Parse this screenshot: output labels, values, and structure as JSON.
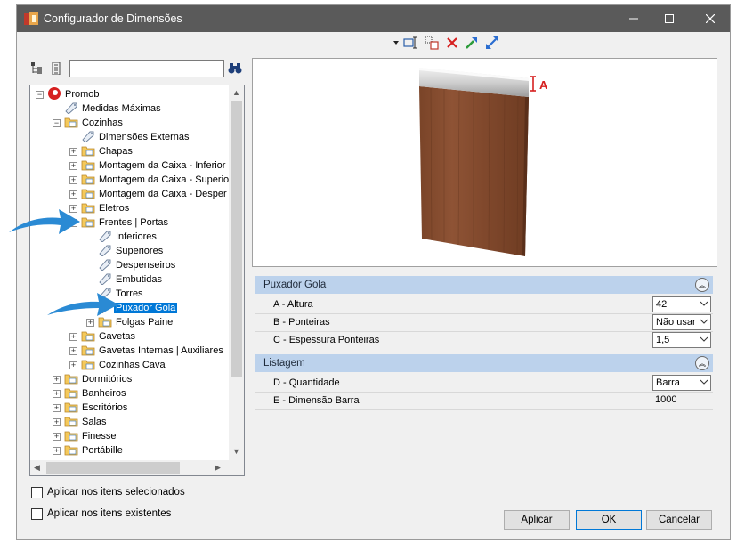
{
  "window": {
    "title": "Configurador de Dimensões"
  },
  "toolbar": {
    "icons": [
      "dropdown-arrow-icon",
      "text-frame-icon",
      "copy-dimension-icon",
      "delete-icon",
      "arrow-up-right-icon",
      "arrow-diagonal-icon"
    ]
  },
  "tree": {
    "items": [
      {
        "label": "Promob",
        "level": 0,
        "expander": "minus",
        "icon": "promob-logo-icon",
        "selected": false
      },
      {
        "label": "Medidas Máximas",
        "level": 1,
        "expander": "",
        "icon": "tag-icon",
        "selected": false
      },
      {
        "label": "Cozinhas",
        "level": 1,
        "expander": "minus",
        "icon": "folder-icon",
        "selected": false
      },
      {
        "label": "Dimensões Externas",
        "level": 2,
        "expander": "",
        "icon": "tag-icon",
        "selected": false
      },
      {
        "label": "Chapas",
        "level": 2,
        "expander": "plus",
        "icon": "folder-icon",
        "selected": false
      },
      {
        "label": "Montagem da Caixa - Inferior",
        "level": 2,
        "expander": "plus",
        "icon": "folder-icon",
        "selected": false
      },
      {
        "label": "Montagem da Caixa - Superio",
        "level": 2,
        "expander": "plus",
        "icon": "folder-icon",
        "selected": false
      },
      {
        "label": "Montagem da Caixa - Desper",
        "level": 2,
        "expander": "plus",
        "icon": "folder-icon",
        "selected": false
      },
      {
        "label": "Eletros",
        "level": 2,
        "expander": "plus",
        "icon": "folder-icon",
        "selected": false
      },
      {
        "label": "Frentes | Portas",
        "level": 2,
        "expander": "minus",
        "icon": "folder-icon",
        "selected": false
      },
      {
        "label": "Inferiores",
        "level": 3,
        "expander": "",
        "icon": "tag-icon",
        "selected": false
      },
      {
        "label": "Superiores",
        "level": 3,
        "expander": "",
        "icon": "tag-icon",
        "selected": false
      },
      {
        "label": "Despenseiros",
        "level": 3,
        "expander": "",
        "icon": "tag-icon",
        "selected": false
      },
      {
        "label": "Embutidas",
        "level": 3,
        "expander": "",
        "icon": "tag-icon",
        "selected": false
      },
      {
        "label": "Torres",
        "level": 3,
        "expander": "",
        "icon": "tag-icon",
        "selected": false
      },
      {
        "label": "Puxador Gola",
        "level": 3,
        "expander": "",
        "icon": "tag-icon",
        "selected": true
      },
      {
        "label": "Folgas Painel",
        "level": 3,
        "expander": "plus",
        "icon": "folder-icon",
        "selected": false
      },
      {
        "label": "Gavetas",
        "level": 2,
        "expander": "plus",
        "icon": "folder-icon",
        "selected": false
      },
      {
        "label": "Gavetas Internas | Auxiliares",
        "level": 2,
        "expander": "plus",
        "icon": "folder-icon",
        "selected": false
      },
      {
        "label": "Cozinhas Cava",
        "level": 2,
        "expander": "plus",
        "icon": "folder-icon",
        "selected": false
      },
      {
        "label": "Dormitórios",
        "level": 1,
        "expander": "plus",
        "icon": "folder-icon",
        "selected": false
      },
      {
        "label": "Banheiros",
        "level": 1,
        "expander": "plus",
        "icon": "folder-icon",
        "selected": false
      },
      {
        "label": "Escritórios",
        "level": 1,
        "expander": "plus",
        "icon": "folder-icon",
        "selected": false
      },
      {
        "label": "Salas",
        "level": 1,
        "expander": "plus",
        "icon": "folder-icon",
        "selected": false
      },
      {
        "label": "Finesse",
        "level": 1,
        "expander": "plus",
        "icon": "folder-icon",
        "selected": false
      },
      {
        "label": "Portábille",
        "level": 1,
        "expander": "plus",
        "icon": "folder-icon",
        "selected": false
      }
    ]
  },
  "preview": {
    "dimension_label": "A"
  },
  "groups": [
    {
      "title": "Puxador Gola",
      "rows": [
        {
          "name": "A - Altura",
          "value": "42",
          "dropdown": true
        },
        {
          "name": "B - Ponteiras",
          "value": "Não usar",
          "dropdown": true
        },
        {
          "name": "C - Espessura Ponteiras",
          "value": "1,5",
          "dropdown": true
        }
      ]
    },
    {
      "title": "Listagem",
      "rows": [
        {
          "name": "D - Quantidade",
          "value": "Barra",
          "dropdown": true
        },
        {
          "name": "E - Dimensão Barra",
          "value": "1000",
          "dropdown": false
        }
      ]
    }
  ],
  "options": {
    "apply_selected": "Aplicar nos itens selecionados",
    "apply_existing": "Aplicar nos itens existentes"
  },
  "buttons": {
    "apply": "Aplicar",
    "ok": "OK",
    "cancel": "Cancelar"
  }
}
